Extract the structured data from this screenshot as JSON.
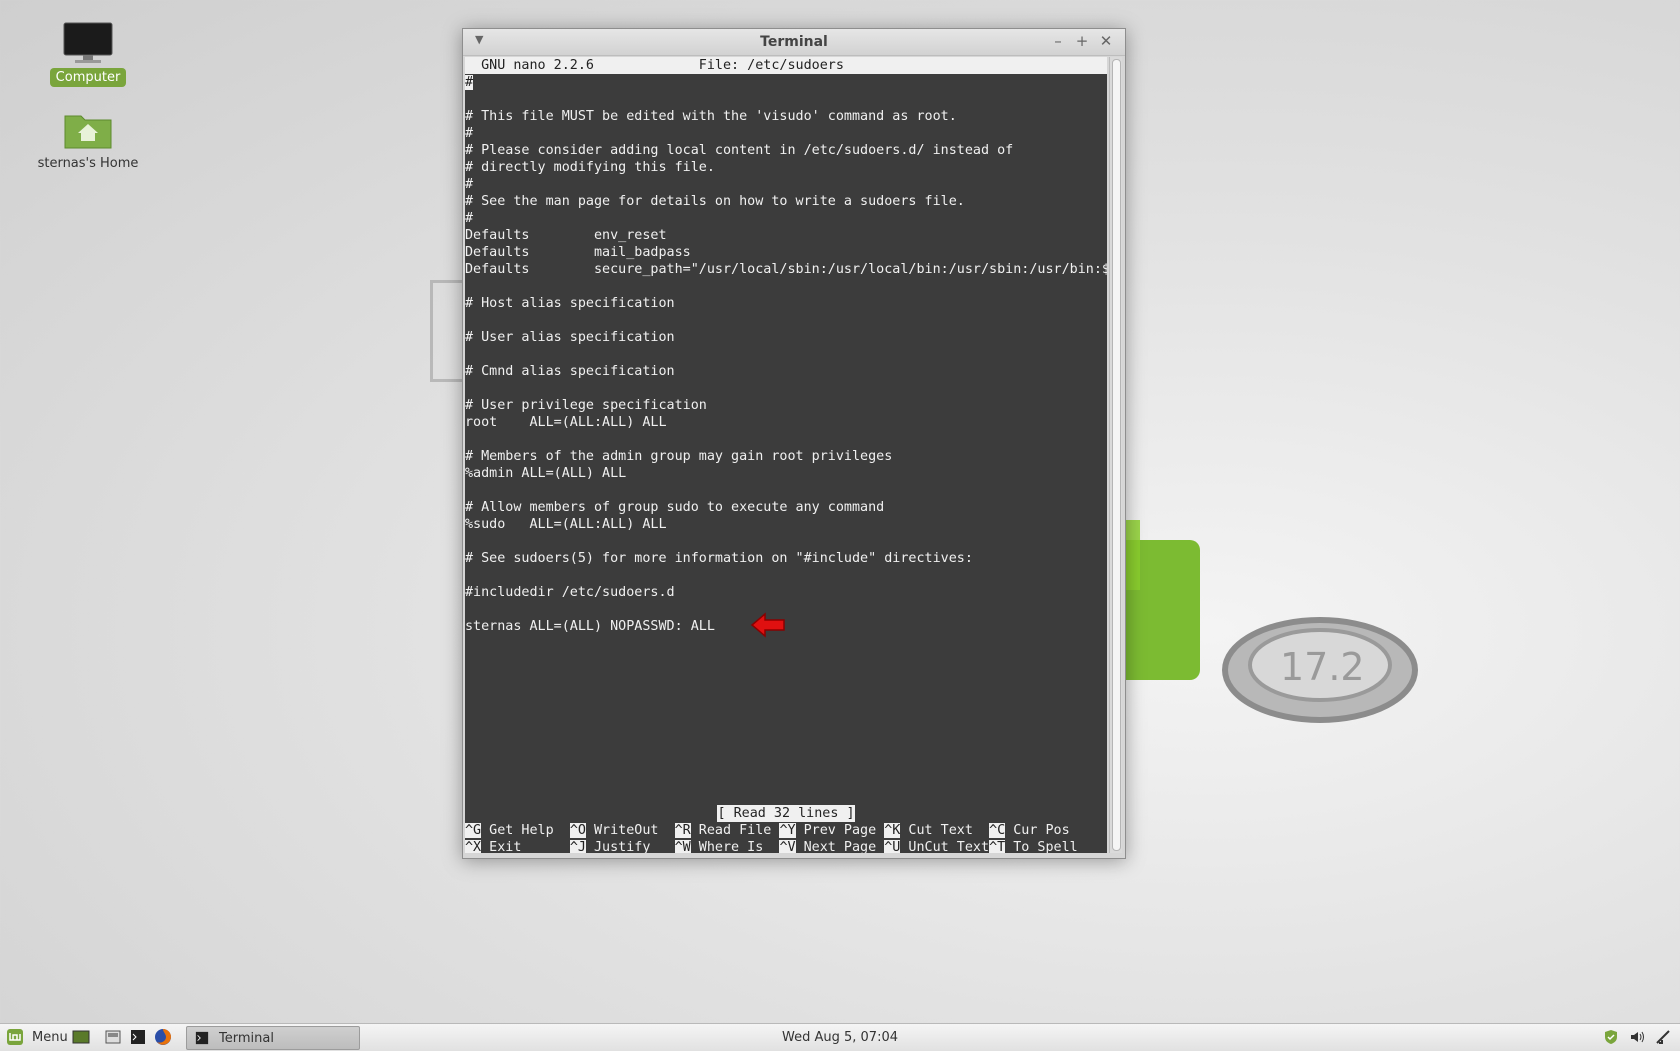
{
  "desktop": {
    "icons": [
      {
        "label": "Computer"
      },
      {
        "label": "sternas's Home"
      }
    ]
  },
  "window": {
    "title": "Terminal",
    "controls": {
      "minimize": "–",
      "maximize": "+",
      "close": "✕"
    }
  },
  "nano": {
    "header": "  GNU nano 2.2.6             File: /etc/sudoers                                ",
    "cursor_char": "#",
    "lines": [
      "",
      "",
      "# This file MUST be edited with the 'visudo' command as root.",
      "#",
      "# Please consider adding local content in /etc/sudoers.d/ instead of",
      "# directly modifying this file.",
      "#",
      "# See the man page for details on how to write a sudoers file.",
      "#",
      "Defaults        env_reset",
      "Defaults        mail_badpass",
      "Defaults        secure_path=\"/usr/local/sbin:/usr/local/bin:/usr/sbin:/usr/bin:$",
      "",
      "# Host alias specification",
      "",
      "# User alias specification",
      "",
      "# Cmnd alias specification",
      "",
      "# User privilege specification",
      "root    ALL=(ALL:ALL) ALL",
      "",
      "# Members of the admin group may gain root privileges",
      "%admin ALL=(ALL) ALL",
      "",
      "# Allow members of group sudo to execute any command",
      "%sudo   ALL=(ALL:ALL) ALL",
      "",
      "# See sudoers(5) for more information on \"#include\" directives:",
      "",
      "#includedir /etc/sudoers.d",
      "",
      "sternas ALL=(ALL) NOPASSWD: ALL",
      "",
      "",
      "",
      "",
      "",
      "",
      "",
      "",
      "",
      ""
    ],
    "status": "[ Read 32 lines ]",
    "shortcuts_row1": [
      {
        "key": "^G",
        "label": " Get Help  "
      },
      {
        "key": "^O",
        "label": " WriteOut  "
      },
      {
        "key": "^R",
        "label": " Read File "
      },
      {
        "key": "^Y",
        "label": " Prev Page "
      },
      {
        "key": "^K",
        "label": " Cut Text  "
      },
      {
        "key": "^C",
        "label": " Cur Pos"
      }
    ],
    "shortcuts_row2": [
      {
        "key": "^X",
        "label": " Exit      "
      },
      {
        "key": "^J",
        "label": " Justify   "
      },
      {
        "key": "^W",
        "label": " Where Is  "
      },
      {
        "key": "^V",
        "label": " Next Page "
      },
      {
        "key": "^U",
        "label": " UnCut Text"
      },
      {
        "key": "^T",
        "label": " To Spell"
      }
    ]
  },
  "taskbar": {
    "menu_label": "Menu",
    "task_label": "Terminal",
    "clock": "Wed Aug  5, 07:04"
  },
  "colors": {
    "terminal_bg": "#3c3c3c",
    "mint_green": "#7aa53c",
    "arrow_red": "#e01010"
  }
}
